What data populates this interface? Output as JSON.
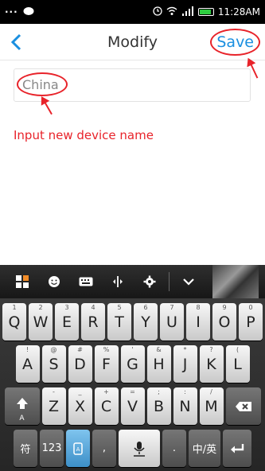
{
  "status_bar": {
    "left_icons": [
      "more-dots-icon",
      "chat-icon"
    ],
    "right_icons": [
      "alarm-icon",
      "wifi-icon",
      "signal-icon",
      "battery-icon"
    ],
    "time": "11:28AM"
  },
  "header": {
    "back_icon": "chevron-left-icon",
    "title": "Modify",
    "save_label": "Save"
  },
  "form": {
    "device_name_value": "China"
  },
  "annotation": {
    "hint": "Input new device name",
    "accent_color": "#e8232a"
  },
  "keyboard": {
    "toolbar_icons": [
      "apps-icon",
      "emoji-icon",
      "keyboard-icon",
      "cursor-icon",
      "settings-icon",
      "collapse-icon"
    ],
    "row1": [
      {
        "label": "Q",
        "sub": "1"
      },
      {
        "label": "W",
        "sub": "2"
      },
      {
        "label": "E",
        "sub": "3"
      },
      {
        "label": "R",
        "sub": "4"
      },
      {
        "label": "T",
        "sub": "5"
      },
      {
        "label": "Y",
        "sub": "6"
      },
      {
        "label": "U",
        "sub": "7"
      },
      {
        "label": "I",
        "sub": "8"
      },
      {
        "label": "O",
        "sub": "9"
      },
      {
        "label": "P",
        "sub": "0"
      }
    ],
    "row2": [
      {
        "label": "A",
        "sub": "!"
      },
      {
        "label": "S",
        "sub": "@"
      },
      {
        "label": "D",
        "sub": "#"
      },
      {
        "label": "F",
        "sub": "%"
      },
      {
        "label": "G",
        "sub": "'"
      },
      {
        "label": "H",
        "sub": "&"
      },
      {
        "label": "J",
        "sub": "*"
      },
      {
        "label": "K",
        "sub": "?"
      },
      {
        "label": "L",
        "sub": "("
      }
    ],
    "row3": [
      {
        "label": "Z",
        "sub": "-"
      },
      {
        "label": "X",
        "sub": "_"
      },
      {
        "label": "C",
        "sub": "+"
      },
      {
        "label": "V",
        "sub": "="
      },
      {
        "label": "B",
        "sub": ";"
      },
      {
        "label": "N",
        "sub": ":"
      },
      {
        "label": "M",
        "sub": "/"
      }
    ],
    "shift_sub": "A",
    "symbol_label": "符",
    "num_label": "123",
    "comma_label": ",",
    "period_label": ".",
    "lang_label": "中/英"
  }
}
